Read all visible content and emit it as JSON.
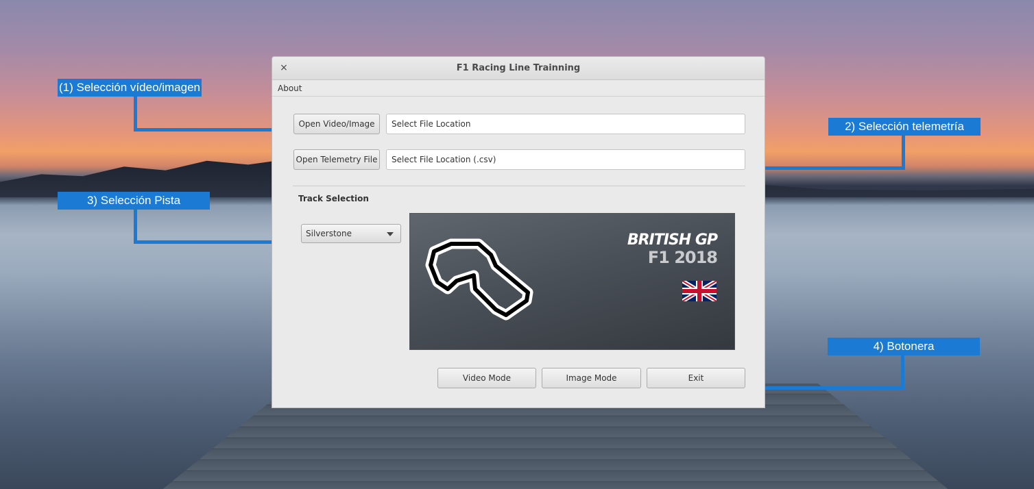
{
  "window": {
    "title": "F1 Racing Line Trainning",
    "close_glyph": "×",
    "menu": [
      "About"
    ]
  },
  "file_selection": {
    "open_video_label": "Open Video/Image",
    "video_location": "Select File Location",
    "open_telemetry_label": "Open Telemetry File",
    "telemetry_location": "Select File Location (.csv)"
  },
  "track": {
    "section_title": "Track Selection",
    "selected": "Silverstone",
    "image": {
      "title": "BRITISH GP",
      "subtitle": "F1 2018",
      "flag": "union-jack-flag-icon"
    }
  },
  "buttons": {
    "video_mode": "Video Mode",
    "image_mode": "Image Mode",
    "exit": "Exit"
  },
  "annotations": {
    "a1": "(1) Selección vídeo/imagen",
    "a2": "2) Selección telemetría",
    "a3": "3) Selección Pista",
    "a4": "4) Botonera"
  },
  "colors": {
    "annotation": "#1a7ad4",
    "window_bg": "#eaeaea"
  }
}
